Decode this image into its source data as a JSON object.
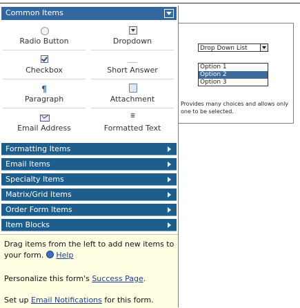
{
  "sections": {
    "common": "Common Items",
    "collapsed": [
      "Formatting Items",
      "Email Items",
      "Specialty Items",
      "Matrix/Grid Items",
      "Order Form Items",
      "Item Blocks"
    ]
  },
  "items": [
    {
      "label": "Radio Button",
      "icon": "radio-icon"
    },
    {
      "label": "Dropdown",
      "icon": "dropdown-icon"
    },
    {
      "label": "Checkbox",
      "icon": "checkbox-icon"
    },
    {
      "label": "Short Answer",
      "icon": "short-answer-icon"
    },
    {
      "label": "Paragraph",
      "icon": "paragraph-icon",
      "glyph": "¶"
    },
    {
      "label": "Attachment",
      "icon": "attachment-icon"
    },
    {
      "label": "Email Address",
      "icon": "email-icon"
    },
    {
      "label": "Formatted Text",
      "icon": "formatted-text-icon",
      "glyph": "≣"
    }
  ],
  "help": {
    "drag_text": "Drag items from the left to add new items to your form.",
    "help_link": "Help",
    "success_prefix": "Personalize this form's ",
    "success_link": "Success Page",
    "success_suffix": ".",
    "notify_prefix": "Set up ",
    "notify_link": "Email Notifications",
    "notify_suffix": " for this form."
  },
  "preview": {
    "select_value": "Drop Down List",
    "options": [
      "Option 1",
      "Option 2",
      "Option 3"
    ],
    "selected_option": "Option 2",
    "description": "Provides many choices and allows only one to be selected."
  },
  "colors": {
    "header_active": "#32689f",
    "header_collapsed": "#1e5e8c",
    "help_background": "#ffffe4",
    "link": "#1d3e8f"
  }
}
